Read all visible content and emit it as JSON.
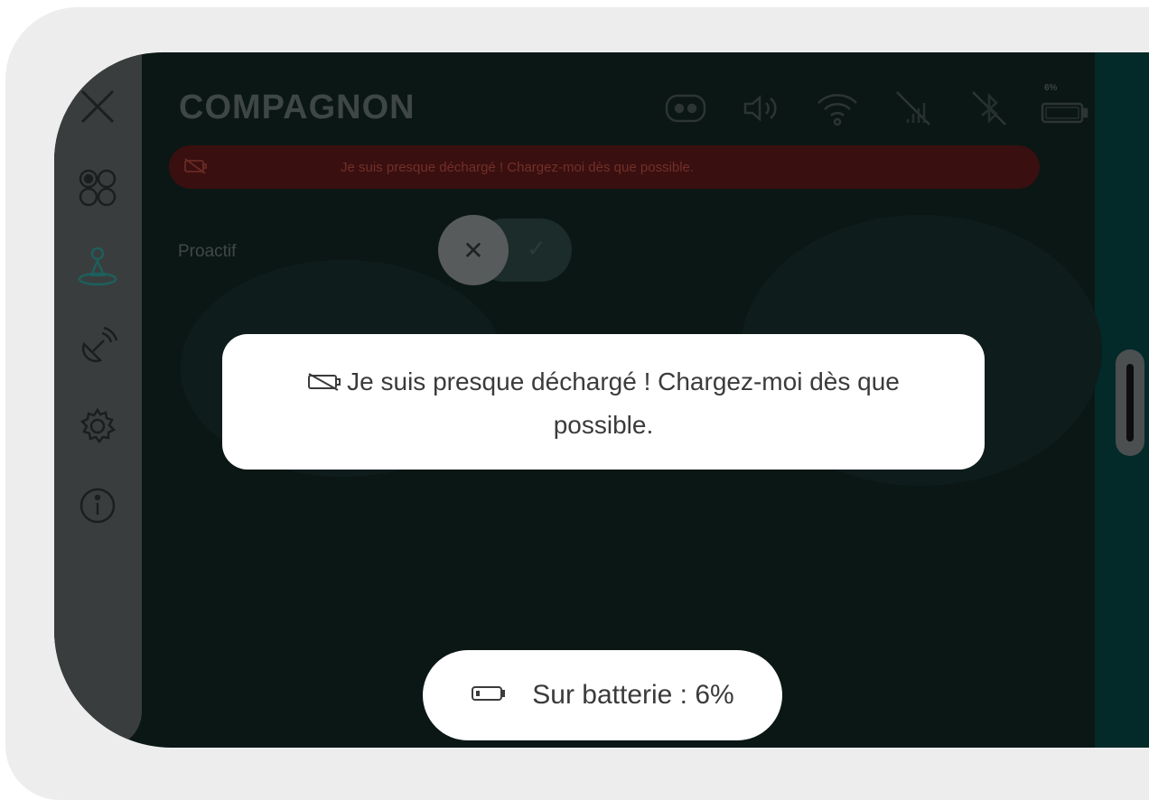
{
  "app": {
    "title": "COMPAGNON"
  },
  "status": {
    "icons": [
      "robot-face-icon",
      "speaker-icon",
      "wifi-icon",
      "cellular-off-icon",
      "bluetooth-off-icon",
      "battery-icon"
    ],
    "battery_percent_label": "6%"
  },
  "sidebar": {
    "items": [
      {
        "name": "close-icon"
      },
      {
        "name": "dashboard-icon"
      },
      {
        "name": "companion-icon",
        "active": true
      },
      {
        "name": "satellite-icon"
      },
      {
        "name": "settings-gear-icon"
      },
      {
        "name": "info-icon"
      }
    ]
  },
  "alert_bar": {
    "text": "Je suis presque déchargé ! Chargez-moi dès que possible."
  },
  "settings": {
    "proactif_label": "Proactif",
    "proactif_value": false
  },
  "toast": {
    "text": "Je suis presque déchargé ! Chargez-moi dès que possible."
  },
  "battery_pill": {
    "text": "Sur batterie : 6%"
  },
  "colors": {
    "frame_bg": "#ededed",
    "device_bg": "#0b1715",
    "accent_teal": "#1d5f5c",
    "alert_red": "#3a0f0f",
    "toast_bg": "#ffffff"
  }
}
